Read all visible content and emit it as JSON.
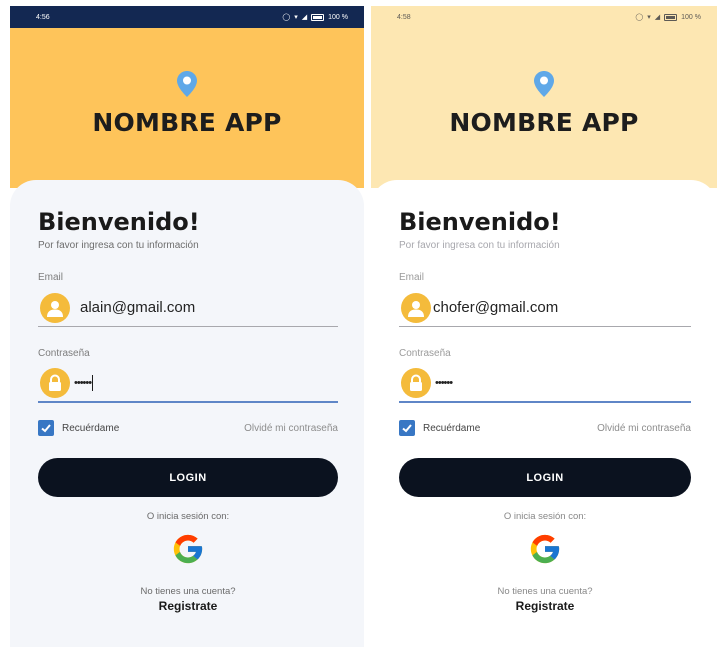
{
  "screens": [
    {
      "status_bar": {
        "time": "4:56",
        "battery": "100 %"
      },
      "header": {
        "app_name": "NOMBRE APP"
      },
      "card": {
        "welcome": "Bienvenido!",
        "subtitle": "Por favor ingresa con tu información",
        "email_label": "Email",
        "email_value": "alain@gmail.com",
        "password_label": "Contraseña",
        "password_value": "••••••",
        "remember_label": "Recuérdame",
        "remember_checked": true,
        "forgot_label": "Olvidé mi contraseña",
        "login_label": "LOGIN",
        "alt_login_label": "O inicia sesión con:",
        "no_account_label": "No tienes una cuenta?",
        "register_label": "Registrate"
      }
    },
    {
      "status_bar": {
        "time": "4:58",
        "battery": "100 %"
      },
      "header": {
        "app_name": "NOMBRE APP"
      },
      "card": {
        "welcome": "Bienvenido!",
        "subtitle": "Por favor ingresa con tu información",
        "email_label": "Email",
        "email_value": "chofer@gmail.com",
        "password_label": "Contraseña",
        "password_value": "••••••",
        "remember_label": "Recuérdame",
        "remember_checked": true,
        "forgot_label": "Olvidé mi contraseña",
        "login_label": "LOGIN",
        "alt_login_label": "O inicia sesión con:",
        "no_account_label": "No tienes una cuenta?",
        "register_label": "Registrate"
      }
    }
  ],
  "icons": {
    "location": "location-pin-icon",
    "user": "user-avatar-icon",
    "lock": "lock-icon",
    "check": "checkmark-icon",
    "google": "google-icon",
    "wifi": "wifi-icon",
    "signal": "signal-icon",
    "battery": "battery-icon",
    "alarm": "alarm-icon"
  },
  "colors": {
    "header_active": "#fec45a",
    "header_faded": "#fde7b2",
    "status_bar_active": "#132852",
    "button": "#0b121f",
    "avatar": "#f4bb3b",
    "checkbox": "#3877c4",
    "pin": "#5fa8e8"
  }
}
